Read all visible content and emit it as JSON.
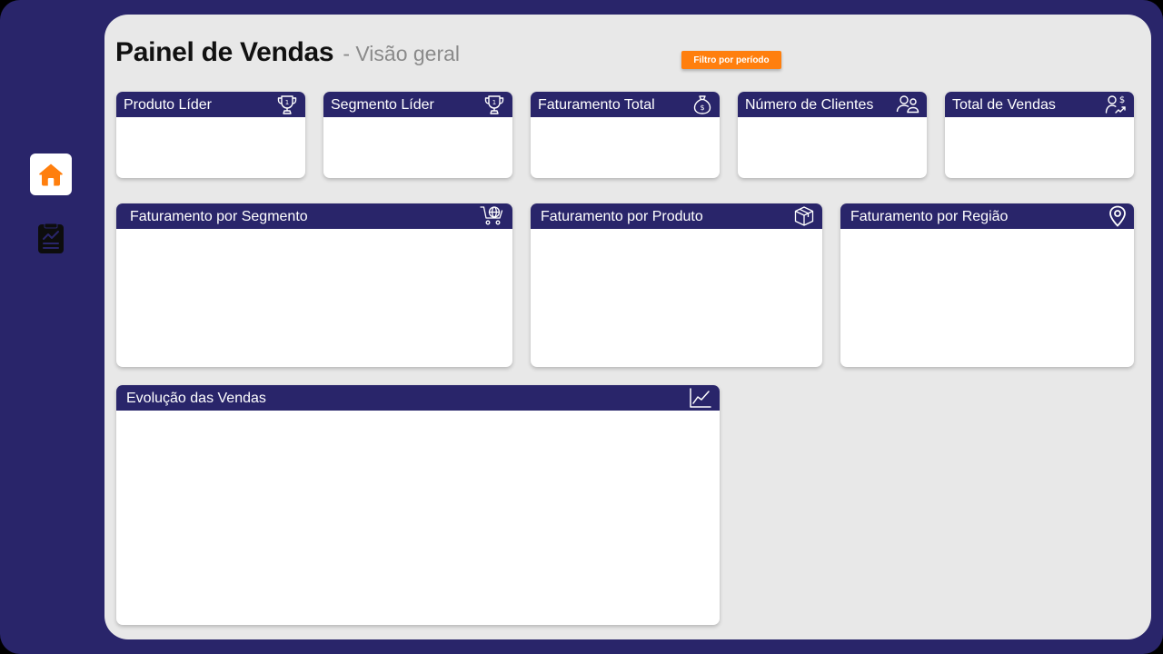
{
  "header": {
    "title": "Painel de Vendas",
    "subtitle": "- Visão geral"
  },
  "filter_button": {
    "label": "Filtro por período"
  },
  "sidebar": {
    "items": [
      {
        "name": "home",
        "icon": "home-icon",
        "active": true
      },
      {
        "name": "report",
        "icon": "report-icon",
        "active": false
      }
    ]
  },
  "kpis": [
    {
      "label": "Produto Líder",
      "icon": "trophy-icon"
    },
    {
      "label": "Segmento Líder",
      "icon": "trophy-icon"
    },
    {
      "label": "Faturamento Total",
      "icon": "money-bag-icon"
    },
    {
      "label": "Número de Clientes",
      "icon": "customers-icon"
    },
    {
      "label": "Total de Vendas",
      "icon": "sales-trend-icon"
    }
  ],
  "panels": [
    {
      "label": "Faturamento por Segmento",
      "icon": "cart-globe-icon"
    },
    {
      "label": "Faturamento por Produto",
      "icon": "package-icon"
    },
    {
      "label": "Faturamento por Região",
      "icon": "location-pin-icon"
    },
    {
      "label": "Evolução das Vendas",
      "icon": "line-chart-icon"
    }
  ],
  "colors": {
    "frame": "#29256a",
    "canvas": "#e8e8e8",
    "card_header": "#29256a",
    "accent": "#ff7f0e"
  }
}
